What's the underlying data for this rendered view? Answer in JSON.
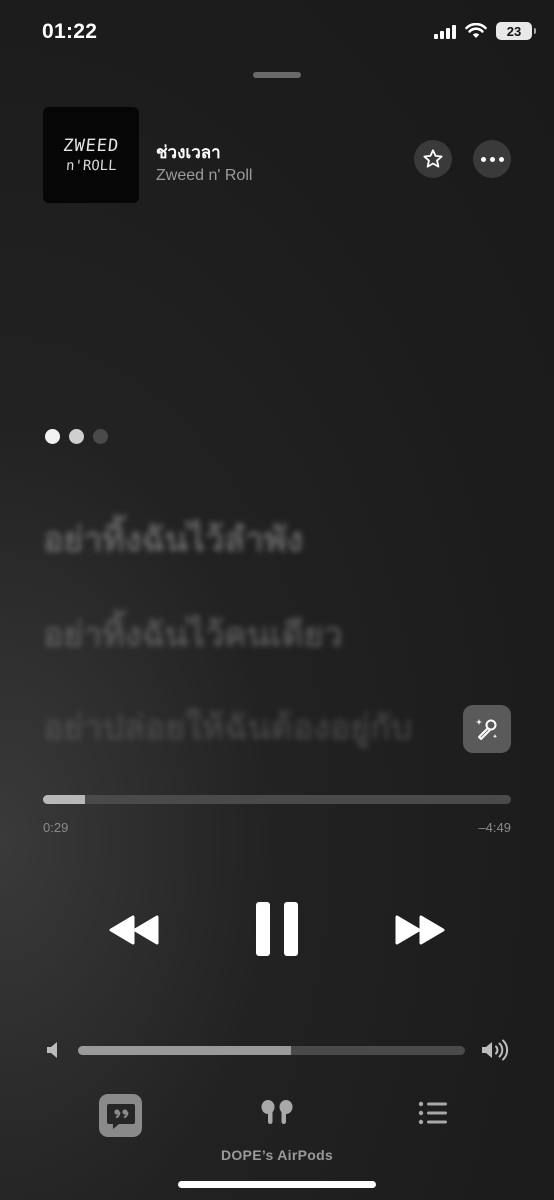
{
  "status_bar": {
    "time": "01:22",
    "battery": "23"
  },
  "now_playing": {
    "artwork_text_line1": "ZWEED",
    "artwork_text_line2": "n'ROLL",
    "title": "ช่วงเวลา",
    "artist": "Zweed n' Roll",
    "star_icon": "star-icon",
    "more_icon": "ellipsis-icon"
  },
  "lyrics": {
    "lines": [
      "อย่าทิ้งฉันไว้ลำพัง",
      "อย่าทิ้งฉันไว้คนเดียว",
      "อย่าปล่อยให้ฉันต้องอยู่กับ"
    ],
    "sing_icon": "microphone-sparkle-icon"
  },
  "playback": {
    "elapsed": "0:29",
    "remaining": "–4:49",
    "progress_fraction": 0.09,
    "prev_icon": "backward-icon",
    "pause_icon": "pause-icon",
    "next_icon": "forward-icon"
  },
  "volume": {
    "level_fraction": 0.55,
    "low_icon": "speaker-low-icon",
    "high_icon": "speaker-high-icon"
  },
  "bottom_bar": {
    "lyrics_icon": "quote-bubble-icon",
    "airplay_icon": "airpods-icon",
    "airplay_label": "DOPE’s AirPods",
    "queue_icon": "list-icon"
  },
  "colors": {
    "background": "#1c1c1c",
    "accent": "#ffffff",
    "muted_text": "#9c9c9c"
  }
}
